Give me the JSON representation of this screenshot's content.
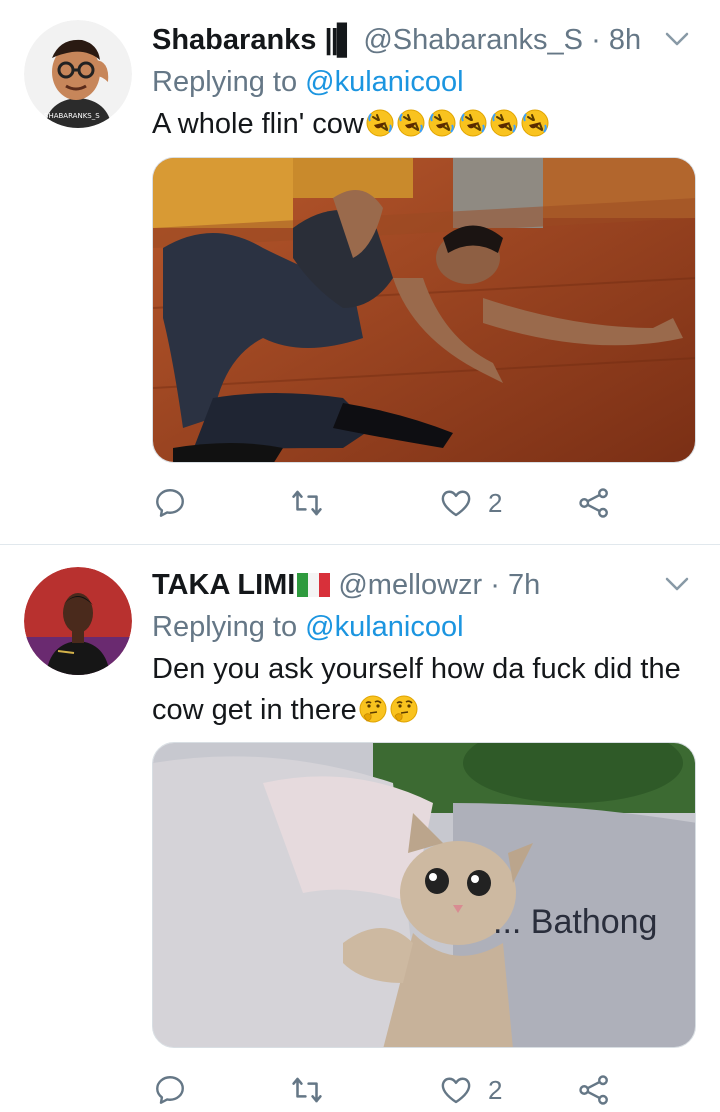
{
  "tweets": [
    {
      "name": "Shabaranks",
      "badge": "||▌",
      "handle": "@Shabaranks_S",
      "separator": "·",
      "time": "8h",
      "replying_prefix": "Replying to",
      "replying_to": "@kulanicool",
      "text": "A whole flin' cow",
      "emoji": "rolling-on-floor-laughing",
      "emoji_count": 6,
      "likes": "2",
      "avatar_text": "SHABARANKS_S"
    },
    {
      "name": "TAKA LIMI",
      "flag": "italy-flag",
      "handle": "@mellowzr",
      "separator": "·",
      "time": "7h",
      "replying_prefix": "Replying to",
      "replying_to": "@kulanicool",
      "text": "Den you ask yourself how da fuck did the cow get in there",
      "emoji": "thinking-face",
      "emoji_count": 2,
      "likes": "2",
      "media_caption": "... Bathong"
    }
  ],
  "colors": {
    "link": "#1b95e0",
    "secondary_text": "#657786",
    "divider": "#e1e8ed",
    "icon": "#657786"
  },
  "icons": [
    "reply-icon",
    "retweet-icon",
    "like-icon",
    "share-icon",
    "chevron-down-icon"
  ]
}
